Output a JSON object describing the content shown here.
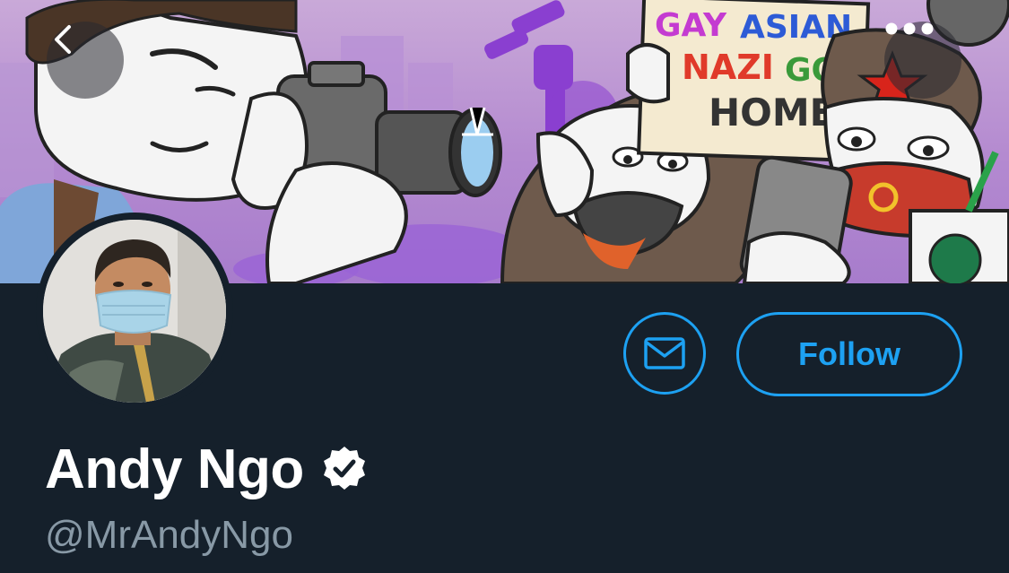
{
  "header": {
    "banner_sign": {
      "line1_left": "GAY",
      "line1_right": "ASIAN",
      "line2_left": "NAZI",
      "line2_right": "GO",
      "line3": "HOME"
    },
    "back_icon": "chevron-left-icon",
    "more_icon": "more-horizontal-icon"
  },
  "profile": {
    "display_name": "Andy Ngo",
    "handle": "@MrAndyNgo",
    "verified": true,
    "verified_icon": "verified-badge-icon"
  },
  "actions": {
    "message_icon": "envelope-icon",
    "follow_label": "Follow"
  },
  "colors": {
    "background": "#15202b",
    "accent": "#1da1f2",
    "handle_text": "#8899a6",
    "name_text": "#ffffff"
  }
}
